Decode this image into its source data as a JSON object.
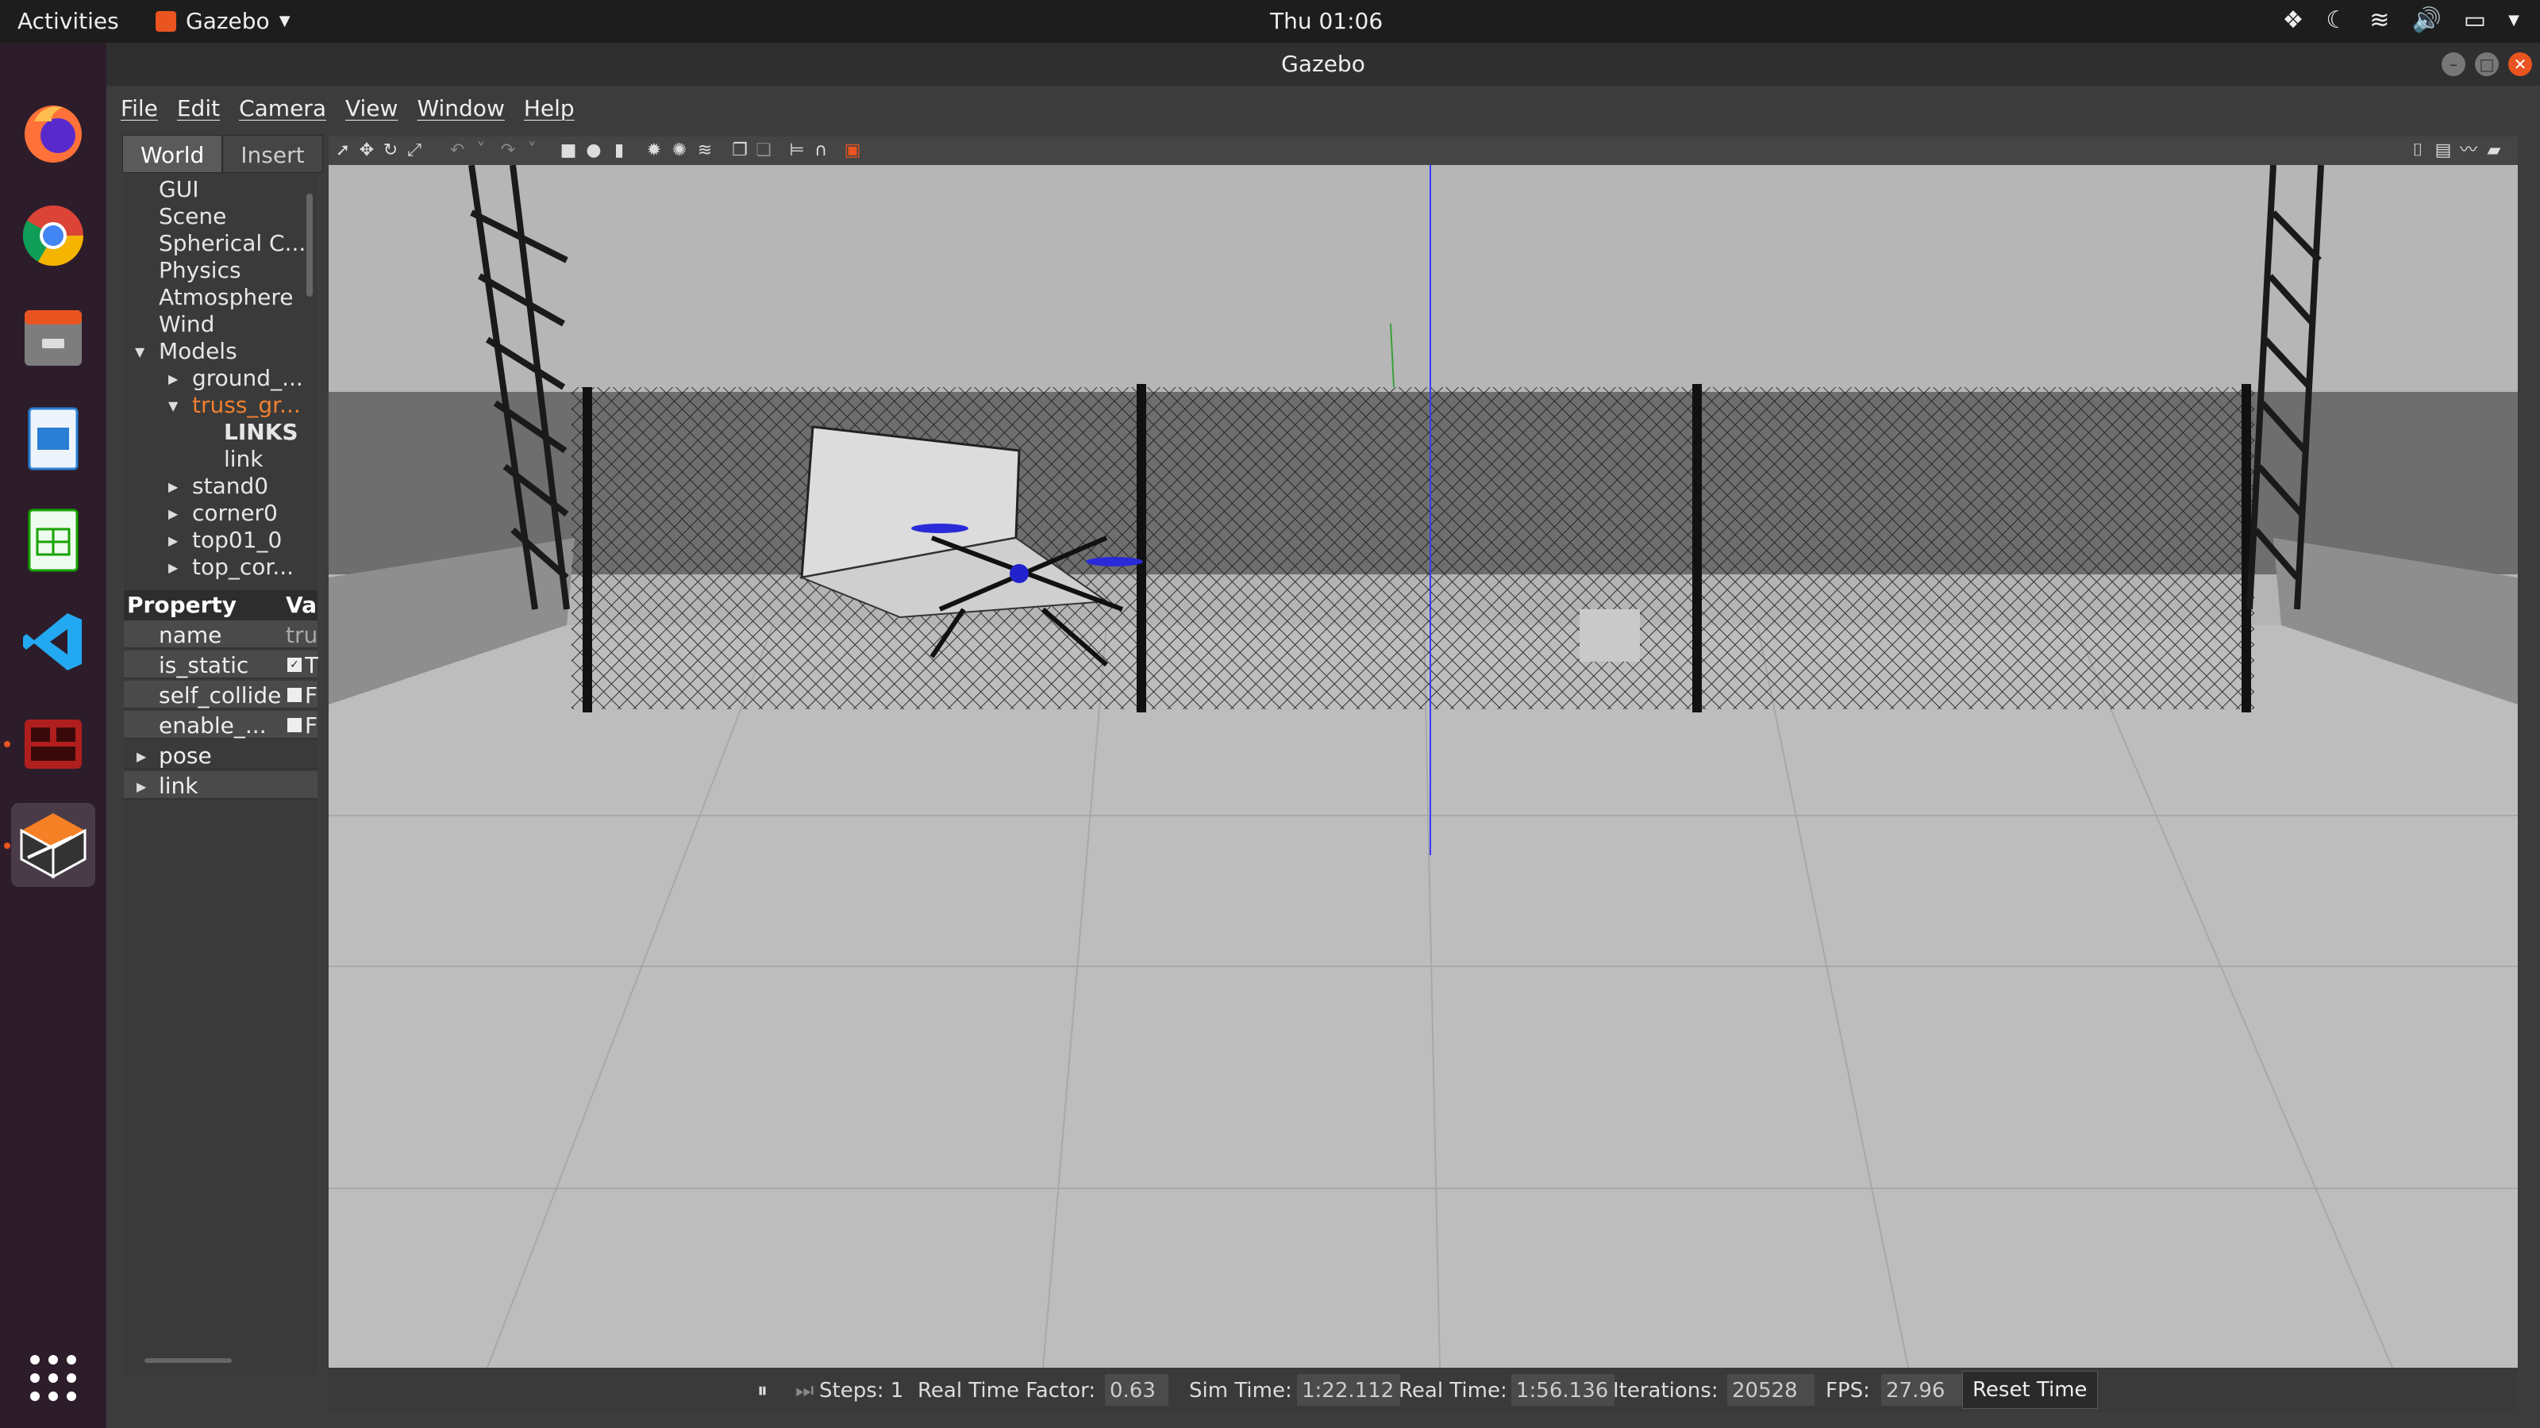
{
  "topbar": {
    "activities": "Activities",
    "app_name": "Gazebo",
    "clock": "Thu 01:06"
  },
  "dock": {
    "apps": [
      "firefox-icon",
      "chrome-icon",
      "files-icon",
      "writer-icon",
      "calc-icon",
      "vscode-icon",
      "terminal-icon",
      "gazebo-icon",
      "app-grid-icon"
    ]
  },
  "window": {
    "title": "Gazebo"
  },
  "menu": {
    "file": "File",
    "edit": "Edit",
    "camera": "Camera",
    "view": "View",
    "window": "Window",
    "help": "Help"
  },
  "tabs": {
    "world": "World",
    "insert": "Insert"
  },
  "tree": {
    "gui": "GUI",
    "scene": "Scene",
    "spherical": "Spherical C...",
    "physics": "Physics",
    "atmosphere": "Atmosphere",
    "wind": "Wind",
    "models": "Models",
    "ground": "ground_...",
    "truss": "truss_gr...",
    "links": "LINKS",
    "link": "link",
    "stand0": "stand0",
    "corner0": "corner0",
    "top01": "top01_0",
    "topcor": "top_cor..."
  },
  "props": {
    "header_property": "Property",
    "header_value": "Va",
    "rows": [
      {
        "name": "name",
        "value": "tru"
      },
      {
        "name": "is_static",
        "value": "T"
      },
      {
        "name": "self_collide",
        "value": "F"
      },
      {
        "name": "enable_...",
        "value": "F"
      }
    ],
    "pose": "pose",
    "link": "link"
  },
  "status": {
    "steps_label": "Steps: 1",
    "rtf_label": "Real Time Factor:",
    "rtf_value": "0.63",
    "sim_label": "Sim Time:",
    "sim_value": "1:22.112",
    "real_label": "Real Time:",
    "real_value": "1:56.136",
    "iter_label": "Iterations:",
    "iter_value": "20528",
    "fps_label": "FPS:",
    "fps_value": "27.96",
    "reset": "Reset Time"
  },
  "colors": {
    "accent": "#e95420",
    "selected_tree": "#f08030"
  }
}
